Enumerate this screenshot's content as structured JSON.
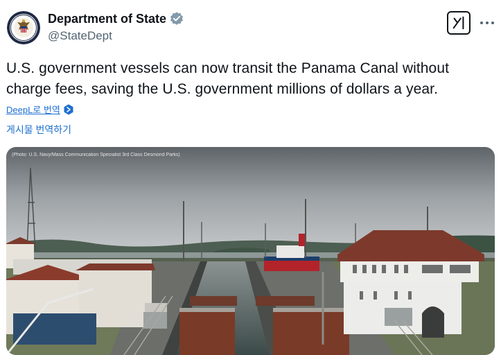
{
  "account": {
    "display_name": "Department of State",
    "handle": "@StateDept",
    "verified_badge": "verified-badge-gray",
    "avatar": "department-of-state-seal"
  },
  "post": {
    "text": "U.S. government vessels can now transit the Panama Canal without charge fees, saving the U.S. government millions of dollars a year.",
    "translate_deepl_label": "DeepL로 번역",
    "translate_post_label": "게시물 번역하기"
  },
  "media": {
    "photo_credit": "(Photo: U.S. Navy/Mass Communication Specialist 3rd Class Desmond Parks)",
    "description_icon": "canal-locks-photo"
  },
  "actions": {
    "grok_icon": "grok-icon",
    "more_icon": "more-options-icon"
  },
  "colors": {
    "link_blue": "#1d6fd1",
    "text_primary": "#0f1419",
    "text_secondary": "#536471",
    "badge_gray": "#829aab"
  }
}
